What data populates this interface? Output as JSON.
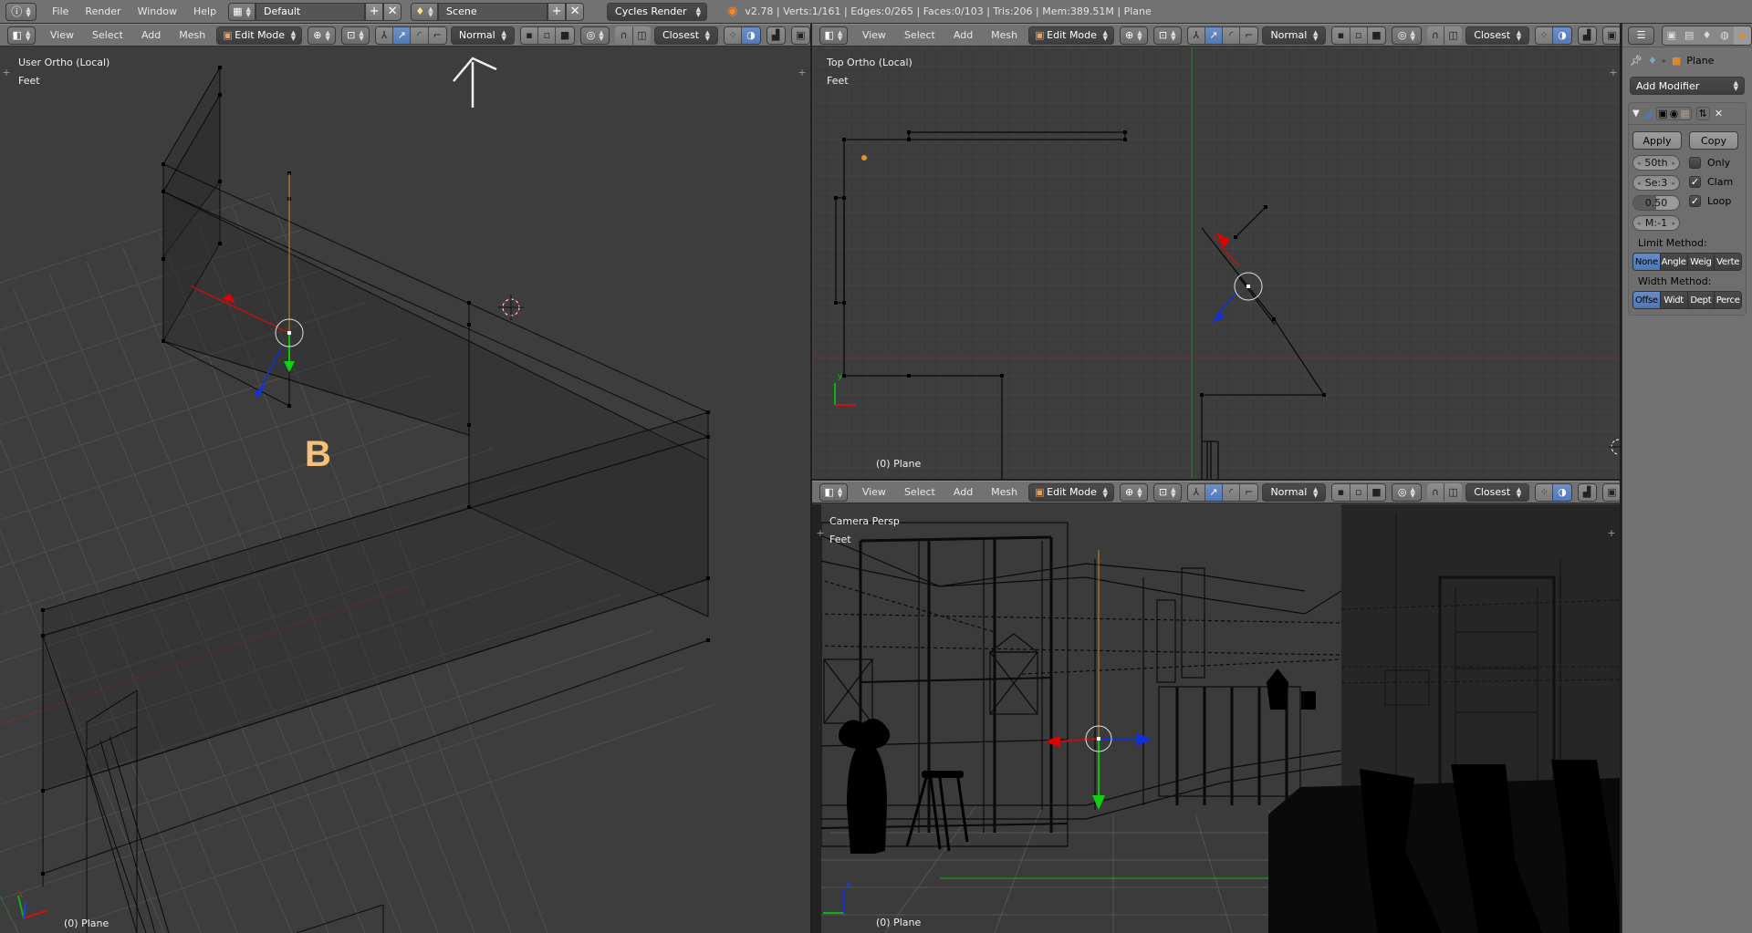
{
  "infobar": {
    "menus": [
      "File",
      "Render",
      "Window",
      "Help"
    ],
    "screen_layout": "Default",
    "scene": "Scene",
    "render_engine": "Cycles Render",
    "stats": "v2.78 | Verts:1/161 | Edges:0/265 | Faces:0/103 | Tris:206 | Mem:389.51M | Plane"
  },
  "viewport_header": {
    "menus": [
      "View",
      "Select",
      "Add",
      "Mesh"
    ],
    "mode": "Edit Mode",
    "orientation": "Normal",
    "snap_target": "Closest"
  },
  "viewports": {
    "left": {
      "view_name": "User Ortho (Local)",
      "units": "Feet",
      "object_label": "(0) Plane",
      "annotation_letter": "B"
    },
    "top_right": {
      "view_name": "Top Ortho (Local)",
      "units": "Feet",
      "object_label": "(0) Plane"
    },
    "bottom_right": {
      "view_name": "Camera Persp",
      "units": "Feet",
      "object_label": "(0) Plane"
    }
  },
  "axis_labels": {
    "x": "x",
    "y": "y",
    "z": "z"
  },
  "properties": {
    "breadcrumb_object": "Plane",
    "add_modifier": "Add Modifier",
    "apply": "Apply",
    "copy": "Copy",
    "fields": {
      "width": "50th",
      "segments": "Se:3",
      "profile": "0.50",
      "profile_value": 0.5,
      "material": "M:-1"
    },
    "checkboxes": [
      {
        "label": "Only",
        "checked": false
      },
      {
        "label": "Clam",
        "checked": true
      },
      {
        "label": "Loop",
        "checked": true
      }
    ],
    "limit_method_label": "Limit Method:",
    "limit_methods": [
      "None",
      "Angle",
      "Weig",
      "Verte"
    ],
    "limit_selected": "None",
    "width_method_label": "Width Method:",
    "width_methods": [
      "Offse",
      "Widt",
      "Dept",
      "Perce"
    ],
    "width_selected": "Offse"
  },
  "colors": {
    "accent_blue": "#5680c2",
    "x_axis": "#e00000",
    "y_axis": "#00c000",
    "z_axis": "#1030e0",
    "annotation": "#f5c07a"
  }
}
